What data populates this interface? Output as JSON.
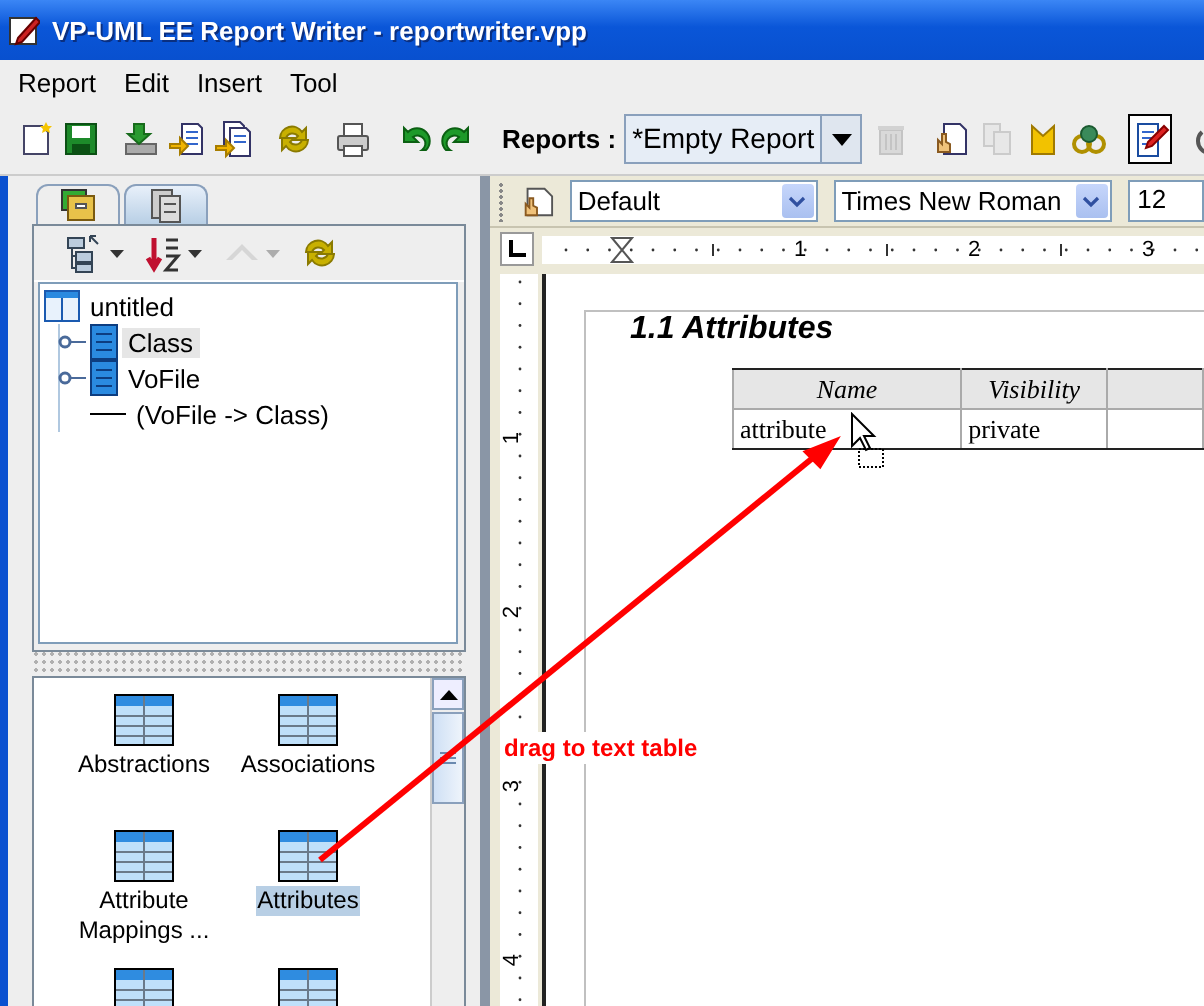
{
  "window": {
    "title": "VP-UML EE Report Writer - reportwriter.vpp"
  },
  "menu": [
    "Report",
    "Edit",
    "Insert",
    "Tool"
  ],
  "toolbar": {
    "buttons": [
      {
        "disabled": false,
        "pressed": false
      },
      {
        "disabled": false,
        "pressed": false
      },
      {
        "disabled": false,
        "pressed": false
      },
      {
        "disabled": false,
        "pressed": false
      },
      {
        "disabled": false,
        "pressed": false
      },
      {
        "disabled": false,
        "pressed": false
      },
      {
        "disabled": false,
        "pressed": false
      },
      {
        "disabled": false,
        "pressed": false
      },
      {
        "disabled": false,
        "pressed": false
      },
      {
        "disabled": true,
        "pressed": false
      },
      {
        "disabled": false,
        "pressed": false
      },
      {
        "disabled": true,
        "pressed": false
      },
      {
        "disabled": false,
        "pressed": false
      },
      {
        "disabled": false,
        "pressed": false
      },
      {
        "disabled": false,
        "pressed": true
      },
      {
        "disabled": false,
        "pressed": false
      }
    ],
    "reports_label": "Reports :",
    "reports_combo": {
      "value": "*Empty Report"
    }
  },
  "left_tabs": [
    {
      "selected": false
    },
    {
      "selected": true
    }
  ],
  "tree_toolbar": [
    {
      "disabled": false
    },
    {
      "disabled": false
    },
    {
      "disabled": true
    },
    {
      "disabled": false
    }
  ],
  "tree": {
    "label": "untitled",
    "expanded": true,
    "children": [
      {
        "label": "Class",
        "kind": "class",
        "expanded": false,
        "selected": true
      },
      {
        "label": "VoFile",
        "kind": "class",
        "expanded": false,
        "selected": false
      },
      {
        "label": "(VoFile -> Class)",
        "kind": "association",
        "selected": false
      }
    ]
  },
  "palette": [
    {
      "label": "Abstractions",
      "selected": false
    },
    {
      "label": "Associations",
      "selected": false
    },
    {
      "label": "Attribute Mappings ...",
      "selected": false
    },
    {
      "label": "Attributes",
      "selected": true
    },
    {
      "selected": false
    },
    {
      "selected": false
    }
  ],
  "editor": {
    "style_combo": {
      "value": "Default"
    },
    "font_combo": {
      "value": "Times New Roman"
    },
    "size_field": {
      "value": "12"
    },
    "ruler_labels": [
      "1",
      "2",
      "3"
    ],
    "vertical_ruler_labels": [
      "1",
      "2",
      "3",
      "4"
    ],
    "heading": "1.1 Attributes",
    "table": {
      "columns": [
        "Name",
        "Visibility"
      ],
      "rows": [
        [
          "attribute",
          "private"
        ]
      ]
    }
  },
  "annotation": {
    "text": "drag to text table"
  }
}
